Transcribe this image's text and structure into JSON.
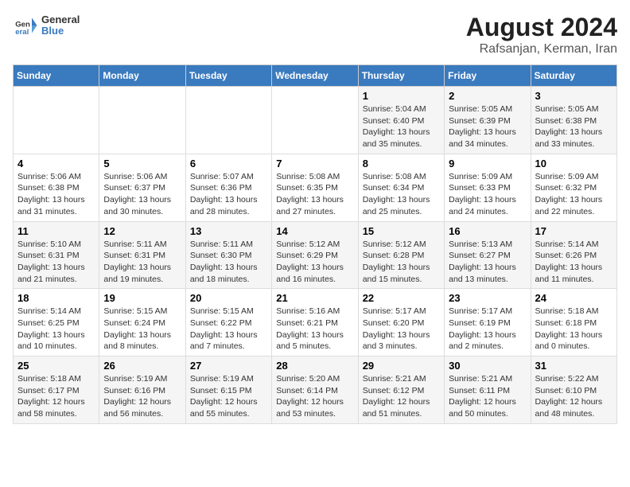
{
  "header": {
    "logo_general": "General",
    "logo_blue": "Blue",
    "month_year": "August 2024",
    "location": "Rafsanjan, Kerman, Iran"
  },
  "weekdays": [
    "Sunday",
    "Monday",
    "Tuesday",
    "Wednesday",
    "Thursday",
    "Friday",
    "Saturday"
  ],
  "weeks": [
    [
      {
        "day": "",
        "info": ""
      },
      {
        "day": "",
        "info": ""
      },
      {
        "day": "",
        "info": ""
      },
      {
        "day": "",
        "info": ""
      },
      {
        "day": "1",
        "info": "Sunrise: 5:04 AM\nSunset: 6:40 PM\nDaylight: 13 hours\nand 35 minutes."
      },
      {
        "day": "2",
        "info": "Sunrise: 5:05 AM\nSunset: 6:39 PM\nDaylight: 13 hours\nand 34 minutes."
      },
      {
        "day": "3",
        "info": "Sunrise: 5:05 AM\nSunset: 6:38 PM\nDaylight: 13 hours\nand 33 minutes."
      }
    ],
    [
      {
        "day": "4",
        "info": "Sunrise: 5:06 AM\nSunset: 6:38 PM\nDaylight: 13 hours\nand 31 minutes."
      },
      {
        "day": "5",
        "info": "Sunrise: 5:06 AM\nSunset: 6:37 PM\nDaylight: 13 hours\nand 30 minutes."
      },
      {
        "day": "6",
        "info": "Sunrise: 5:07 AM\nSunset: 6:36 PM\nDaylight: 13 hours\nand 28 minutes."
      },
      {
        "day": "7",
        "info": "Sunrise: 5:08 AM\nSunset: 6:35 PM\nDaylight: 13 hours\nand 27 minutes."
      },
      {
        "day": "8",
        "info": "Sunrise: 5:08 AM\nSunset: 6:34 PM\nDaylight: 13 hours\nand 25 minutes."
      },
      {
        "day": "9",
        "info": "Sunrise: 5:09 AM\nSunset: 6:33 PM\nDaylight: 13 hours\nand 24 minutes."
      },
      {
        "day": "10",
        "info": "Sunrise: 5:09 AM\nSunset: 6:32 PM\nDaylight: 13 hours\nand 22 minutes."
      }
    ],
    [
      {
        "day": "11",
        "info": "Sunrise: 5:10 AM\nSunset: 6:31 PM\nDaylight: 13 hours\nand 21 minutes."
      },
      {
        "day": "12",
        "info": "Sunrise: 5:11 AM\nSunset: 6:31 PM\nDaylight: 13 hours\nand 19 minutes."
      },
      {
        "day": "13",
        "info": "Sunrise: 5:11 AM\nSunset: 6:30 PM\nDaylight: 13 hours\nand 18 minutes."
      },
      {
        "day": "14",
        "info": "Sunrise: 5:12 AM\nSunset: 6:29 PM\nDaylight: 13 hours\nand 16 minutes."
      },
      {
        "day": "15",
        "info": "Sunrise: 5:12 AM\nSunset: 6:28 PM\nDaylight: 13 hours\nand 15 minutes."
      },
      {
        "day": "16",
        "info": "Sunrise: 5:13 AM\nSunset: 6:27 PM\nDaylight: 13 hours\nand 13 minutes."
      },
      {
        "day": "17",
        "info": "Sunrise: 5:14 AM\nSunset: 6:26 PM\nDaylight: 13 hours\nand 11 minutes."
      }
    ],
    [
      {
        "day": "18",
        "info": "Sunrise: 5:14 AM\nSunset: 6:25 PM\nDaylight: 13 hours\nand 10 minutes."
      },
      {
        "day": "19",
        "info": "Sunrise: 5:15 AM\nSunset: 6:24 PM\nDaylight: 13 hours\nand 8 minutes."
      },
      {
        "day": "20",
        "info": "Sunrise: 5:15 AM\nSunset: 6:22 PM\nDaylight: 13 hours\nand 7 minutes."
      },
      {
        "day": "21",
        "info": "Sunrise: 5:16 AM\nSunset: 6:21 PM\nDaylight: 13 hours\nand 5 minutes."
      },
      {
        "day": "22",
        "info": "Sunrise: 5:17 AM\nSunset: 6:20 PM\nDaylight: 13 hours\nand 3 minutes."
      },
      {
        "day": "23",
        "info": "Sunrise: 5:17 AM\nSunset: 6:19 PM\nDaylight: 13 hours\nand 2 minutes."
      },
      {
        "day": "24",
        "info": "Sunrise: 5:18 AM\nSunset: 6:18 PM\nDaylight: 13 hours\nand 0 minutes."
      }
    ],
    [
      {
        "day": "25",
        "info": "Sunrise: 5:18 AM\nSunset: 6:17 PM\nDaylight: 12 hours\nand 58 minutes."
      },
      {
        "day": "26",
        "info": "Sunrise: 5:19 AM\nSunset: 6:16 PM\nDaylight: 12 hours\nand 56 minutes."
      },
      {
        "day": "27",
        "info": "Sunrise: 5:19 AM\nSunset: 6:15 PM\nDaylight: 12 hours\nand 55 minutes."
      },
      {
        "day": "28",
        "info": "Sunrise: 5:20 AM\nSunset: 6:14 PM\nDaylight: 12 hours\nand 53 minutes."
      },
      {
        "day": "29",
        "info": "Sunrise: 5:21 AM\nSunset: 6:12 PM\nDaylight: 12 hours\nand 51 minutes."
      },
      {
        "day": "30",
        "info": "Sunrise: 5:21 AM\nSunset: 6:11 PM\nDaylight: 12 hours\nand 50 minutes."
      },
      {
        "day": "31",
        "info": "Sunrise: 5:22 AM\nSunset: 6:10 PM\nDaylight: 12 hours\nand 48 minutes."
      }
    ]
  ]
}
